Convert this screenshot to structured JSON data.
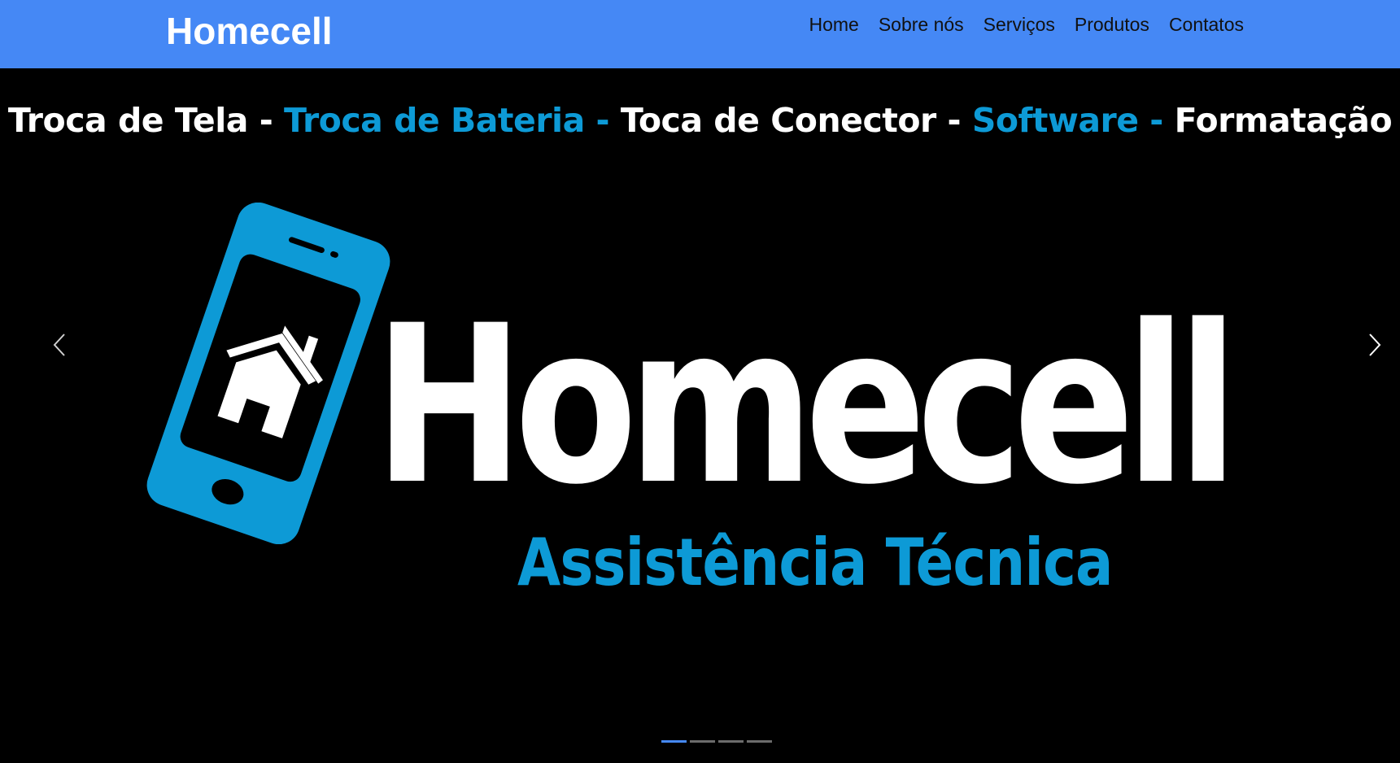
{
  "navbar": {
    "brand": "Homecell",
    "links": [
      "Home",
      "Sobre nós",
      "Serviços",
      "Produtos",
      "Contatos"
    ]
  },
  "banner": {
    "services": [
      {
        "text": "Troca de Tela - ",
        "color": "#ffffff"
      },
      {
        "text": "Troca de Bateria -  ",
        "color": "#0d9ad6"
      },
      {
        "text": "Toca de Conector -  ",
        "color": "#ffffff"
      },
      {
        "text": "Software -   ",
        "color": "#0d9ad6"
      },
      {
        "text": "Formatação",
        "color": "#ffffff"
      }
    ],
    "logo_text": "Homecell",
    "tagline": "Assistência Técnica",
    "icon": "phone-house-icon"
  },
  "carousel": {
    "slide_count": 4,
    "active_index": 0,
    "prev_icon": "chevron-left-icon",
    "next_icon": "chevron-right-icon"
  },
  "colors": {
    "navbar": "#4588f5",
    "accent_blue": "#0d9ad6",
    "background": "#000000"
  }
}
